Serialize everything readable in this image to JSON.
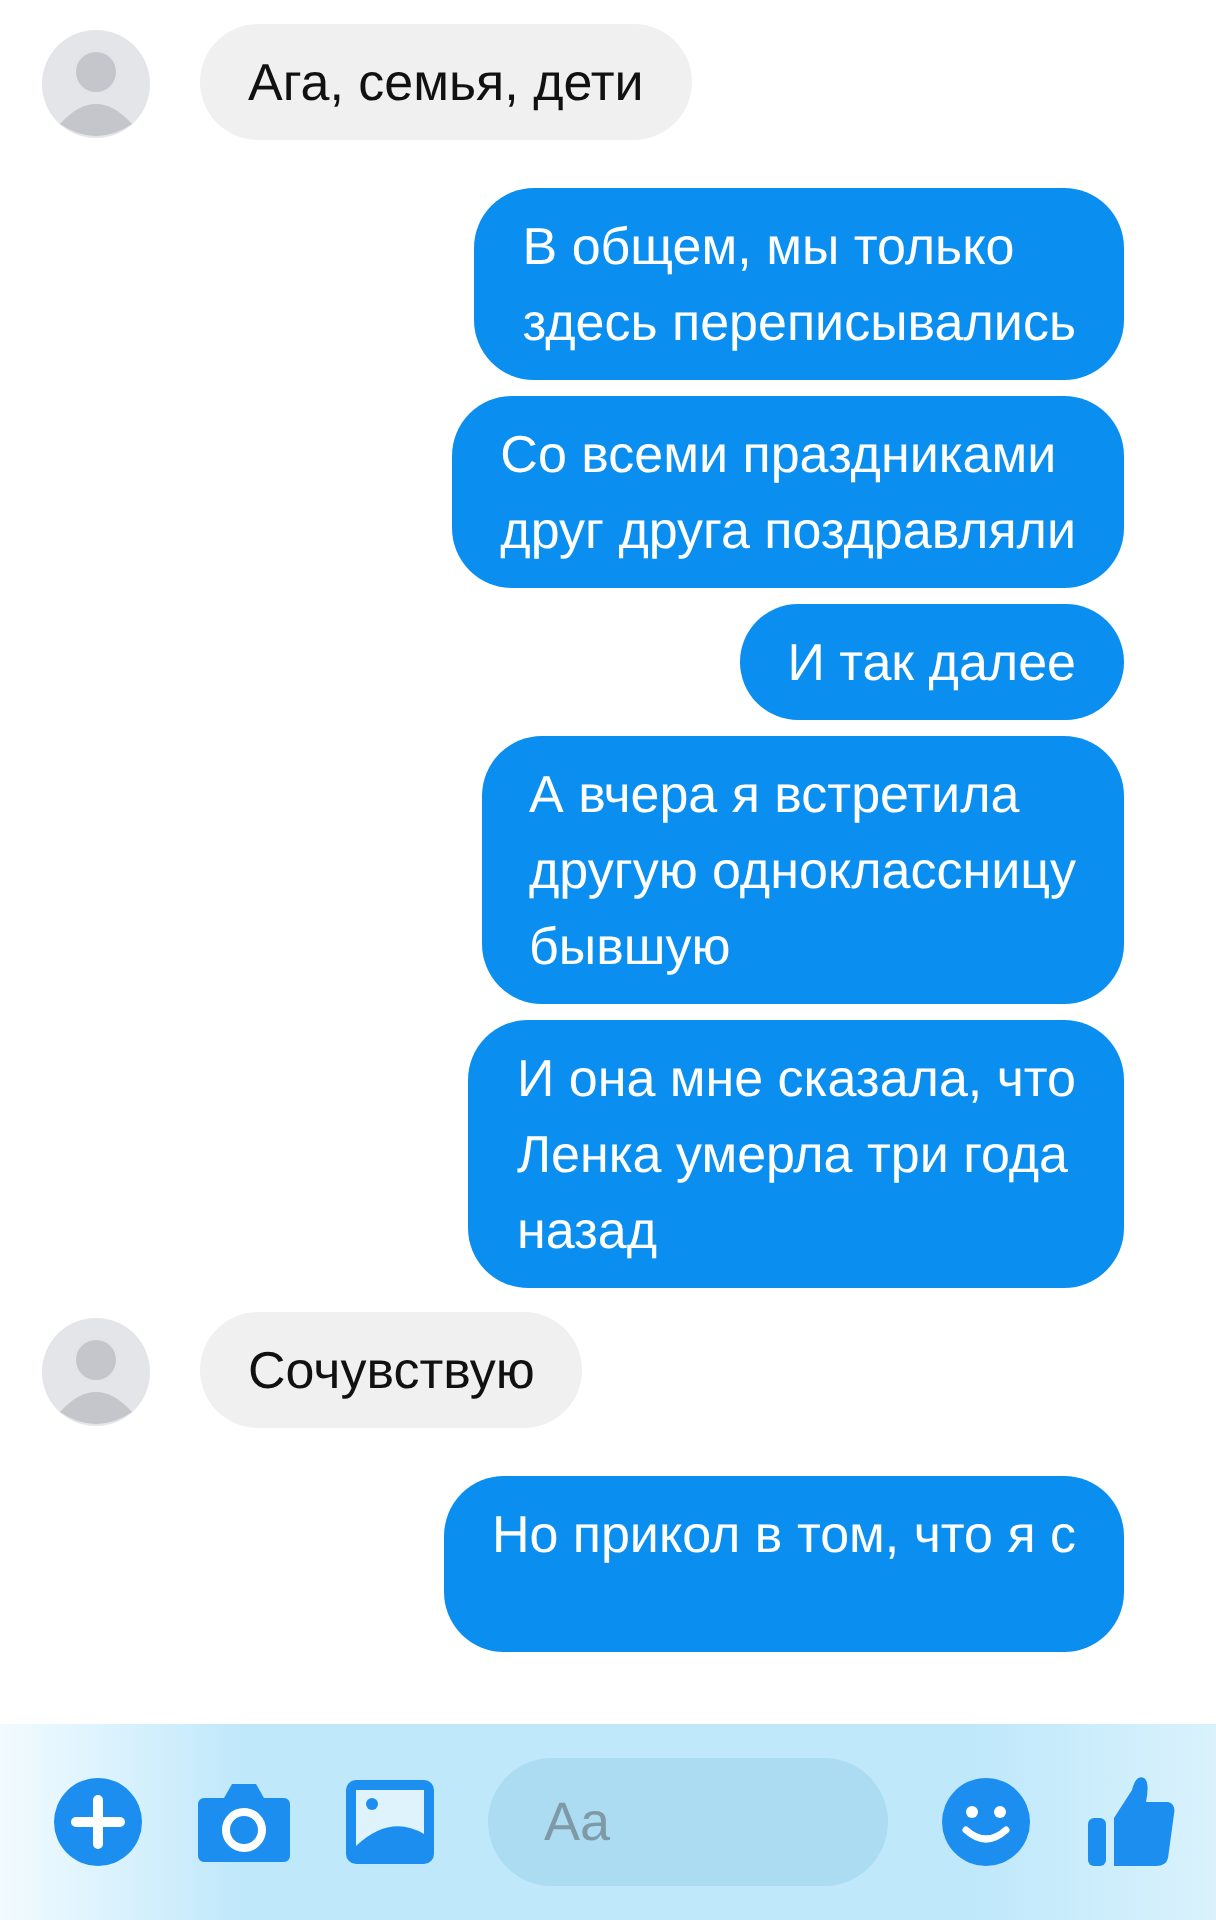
{
  "messages": [
    {
      "kind": "incoming",
      "text": "Ага, семья, дети"
    },
    {
      "kind": "outgoing",
      "text": "В общем, мы только\nздесь переписывались"
    },
    {
      "kind": "outgoing",
      "text": "Со всеми праздниками\nдруг друга поздравляли"
    },
    {
      "kind": "outgoing",
      "text": "И так далее"
    },
    {
      "kind": "outgoing",
      "text": "А вчера я встретила\nдругую одноклассницу\nбывшую"
    },
    {
      "kind": "outgoing",
      "text": "И она мне сказала, что\nЛенка умерла три года\nназад"
    },
    {
      "kind": "incoming",
      "text": "Сочувствую"
    },
    {
      "kind": "outgoing",
      "text": "Но прикол в том, что я с"
    }
  ],
  "composer": {
    "placeholder": "Aa"
  }
}
